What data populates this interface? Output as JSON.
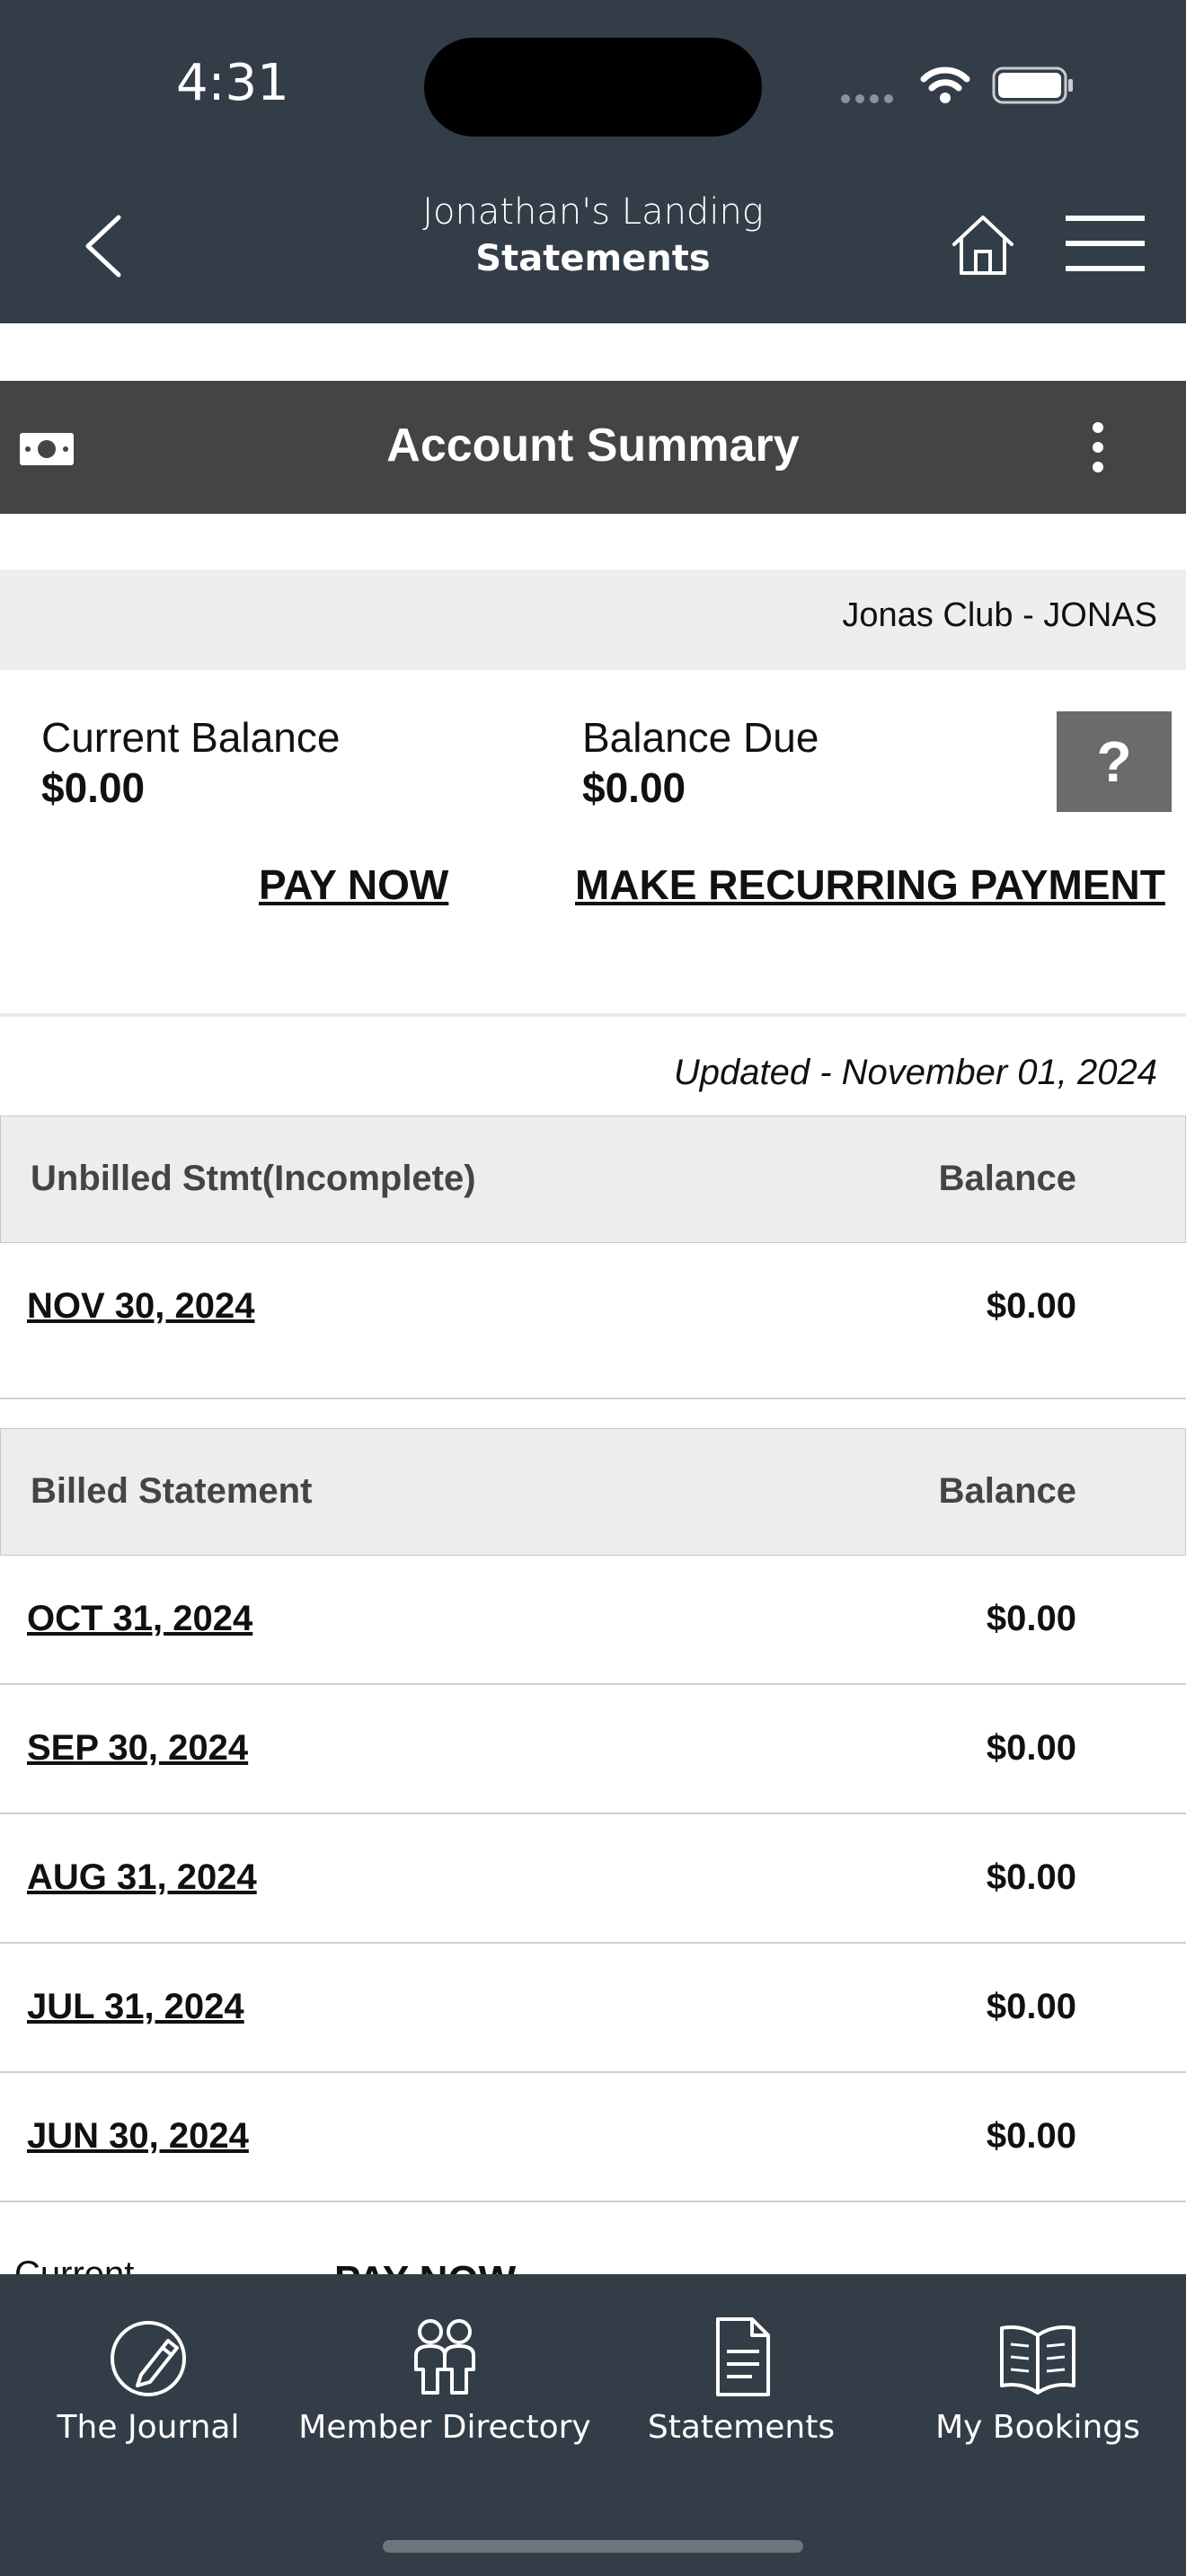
{
  "status": {
    "time": "4:31"
  },
  "header": {
    "club": "Jonathan's Landing",
    "page": "Statements"
  },
  "summary_bar": {
    "title": "Account Summary"
  },
  "club_row": {
    "name": "Jonas Club - JONAS"
  },
  "balances": {
    "current_label": "Current Balance",
    "current_value": "$0.00",
    "due_label": "Balance Due",
    "due_value": "$0.00",
    "help": "?"
  },
  "actions": {
    "pay_now": "PAY NOW",
    "recurring": "MAKE RECURRING PAYMENT"
  },
  "updated": "Updated - November 01, 2024",
  "unbilled": {
    "header_left": "Unbilled Stmt(Incomplete)",
    "header_right": "Balance",
    "rows": [
      {
        "date": "NOV 30, 2024",
        "amount": "$0.00"
      }
    ]
  },
  "billed": {
    "header_left": "Billed Statement",
    "header_right": "Balance",
    "rows": [
      {
        "date": "OCT 31, 2024",
        "amount": "$0.00"
      },
      {
        "date": "SEP 30, 2024",
        "amount": "$0.00"
      },
      {
        "date": "AUG 31, 2024",
        "amount": "$0.00"
      },
      {
        "date": "JUL 31, 2024",
        "amount": "$0.00"
      },
      {
        "date": "JUN 30, 2024",
        "amount": "$0.00"
      }
    ]
  },
  "partial": {
    "left": "Current",
    "right": "PAY NOW"
  },
  "tabs": [
    {
      "label": "The Journal",
      "icon": "journal-icon"
    },
    {
      "label": "Member Directory",
      "icon": "people-icon"
    },
    {
      "label": "Statements",
      "icon": "document-icon"
    },
    {
      "label": "My Bookings",
      "icon": "book-icon"
    }
  ],
  "colors": {
    "header": "#333d47",
    "summary_bar": "#444444",
    "row_band": "#eeeeee"
  }
}
